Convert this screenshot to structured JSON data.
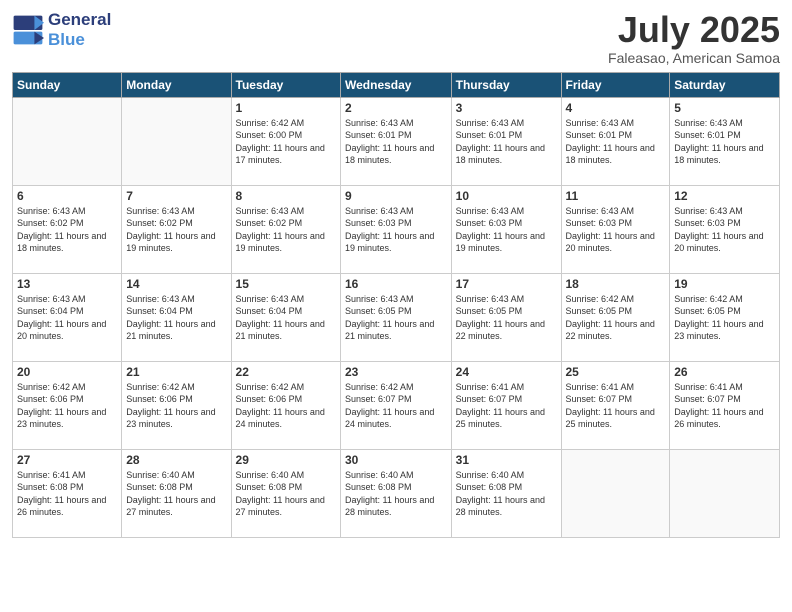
{
  "logo": {
    "line1": "General",
    "line2": "Blue"
  },
  "title": "July 2025",
  "subtitle": "Faleasao, American Samoa",
  "weekdays": [
    "Sunday",
    "Monday",
    "Tuesday",
    "Wednesday",
    "Thursday",
    "Friday",
    "Saturday"
  ],
  "weeks": [
    [
      {
        "day": "",
        "info": ""
      },
      {
        "day": "",
        "info": ""
      },
      {
        "day": "1",
        "info": "Sunrise: 6:42 AM\nSunset: 6:00 PM\nDaylight: 11 hours and 17 minutes."
      },
      {
        "day": "2",
        "info": "Sunrise: 6:43 AM\nSunset: 6:01 PM\nDaylight: 11 hours and 18 minutes."
      },
      {
        "day": "3",
        "info": "Sunrise: 6:43 AM\nSunset: 6:01 PM\nDaylight: 11 hours and 18 minutes."
      },
      {
        "day": "4",
        "info": "Sunrise: 6:43 AM\nSunset: 6:01 PM\nDaylight: 11 hours and 18 minutes."
      },
      {
        "day": "5",
        "info": "Sunrise: 6:43 AM\nSunset: 6:01 PM\nDaylight: 11 hours and 18 minutes."
      }
    ],
    [
      {
        "day": "6",
        "info": "Sunrise: 6:43 AM\nSunset: 6:02 PM\nDaylight: 11 hours and 18 minutes."
      },
      {
        "day": "7",
        "info": "Sunrise: 6:43 AM\nSunset: 6:02 PM\nDaylight: 11 hours and 19 minutes."
      },
      {
        "day": "8",
        "info": "Sunrise: 6:43 AM\nSunset: 6:02 PM\nDaylight: 11 hours and 19 minutes."
      },
      {
        "day": "9",
        "info": "Sunrise: 6:43 AM\nSunset: 6:03 PM\nDaylight: 11 hours and 19 minutes."
      },
      {
        "day": "10",
        "info": "Sunrise: 6:43 AM\nSunset: 6:03 PM\nDaylight: 11 hours and 19 minutes."
      },
      {
        "day": "11",
        "info": "Sunrise: 6:43 AM\nSunset: 6:03 PM\nDaylight: 11 hours and 20 minutes."
      },
      {
        "day": "12",
        "info": "Sunrise: 6:43 AM\nSunset: 6:03 PM\nDaylight: 11 hours and 20 minutes."
      }
    ],
    [
      {
        "day": "13",
        "info": "Sunrise: 6:43 AM\nSunset: 6:04 PM\nDaylight: 11 hours and 20 minutes."
      },
      {
        "day": "14",
        "info": "Sunrise: 6:43 AM\nSunset: 6:04 PM\nDaylight: 11 hours and 21 minutes."
      },
      {
        "day": "15",
        "info": "Sunrise: 6:43 AM\nSunset: 6:04 PM\nDaylight: 11 hours and 21 minutes."
      },
      {
        "day": "16",
        "info": "Sunrise: 6:43 AM\nSunset: 6:05 PM\nDaylight: 11 hours and 21 minutes."
      },
      {
        "day": "17",
        "info": "Sunrise: 6:43 AM\nSunset: 6:05 PM\nDaylight: 11 hours and 22 minutes."
      },
      {
        "day": "18",
        "info": "Sunrise: 6:42 AM\nSunset: 6:05 PM\nDaylight: 11 hours and 22 minutes."
      },
      {
        "day": "19",
        "info": "Sunrise: 6:42 AM\nSunset: 6:05 PM\nDaylight: 11 hours and 23 minutes."
      }
    ],
    [
      {
        "day": "20",
        "info": "Sunrise: 6:42 AM\nSunset: 6:06 PM\nDaylight: 11 hours and 23 minutes."
      },
      {
        "day": "21",
        "info": "Sunrise: 6:42 AM\nSunset: 6:06 PM\nDaylight: 11 hours and 23 minutes."
      },
      {
        "day": "22",
        "info": "Sunrise: 6:42 AM\nSunset: 6:06 PM\nDaylight: 11 hours and 24 minutes."
      },
      {
        "day": "23",
        "info": "Sunrise: 6:42 AM\nSunset: 6:07 PM\nDaylight: 11 hours and 24 minutes."
      },
      {
        "day": "24",
        "info": "Sunrise: 6:41 AM\nSunset: 6:07 PM\nDaylight: 11 hours and 25 minutes."
      },
      {
        "day": "25",
        "info": "Sunrise: 6:41 AM\nSunset: 6:07 PM\nDaylight: 11 hours and 25 minutes."
      },
      {
        "day": "26",
        "info": "Sunrise: 6:41 AM\nSunset: 6:07 PM\nDaylight: 11 hours and 26 minutes."
      }
    ],
    [
      {
        "day": "27",
        "info": "Sunrise: 6:41 AM\nSunset: 6:08 PM\nDaylight: 11 hours and 26 minutes."
      },
      {
        "day": "28",
        "info": "Sunrise: 6:40 AM\nSunset: 6:08 PM\nDaylight: 11 hours and 27 minutes."
      },
      {
        "day": "29",
        "info": "Sunrise: 6:40 AM\nSunset: 6:08 PM\nDaylight: 11 hours and 27 minutes."
      },
      {
        "day": "30",
        "info": "Sunrise: 6:40 AM\nSunset: 6:08 PM\nDaylight: 11 hours and 28 minutes."
      },
      {
        "day": "31",
        "info": "Sunrise: 6:40 AM\nSunset: 6:08 PM\nDaylight: 11 hours and 28 minutes."
      },
      {
        "day": "",
        "info": ""
      },
      {
        "day": "",
        "info": ""
      }
    ]
  ]
}
